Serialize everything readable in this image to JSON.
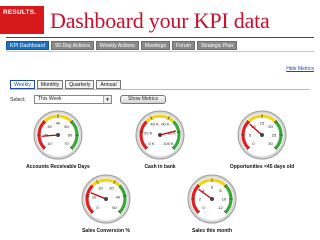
{
  "brand": {
    "line1": "RESULTS.",
    "line2": ""
  },
  "title": "Dashboard your KPI data",
  "main_tabs": [
    {
      "label": "KPI Dashboard",
      "active": true
    },
    {
      "label": "90 Day Actions",
      "active": false
    },
    {
      "label": "Weekly Actions",
      "active": false
    },
    {
      "label": "Meetings",
      "active": false
    },
    {
      "label": "Forum",
      "active": false
    },
    {
      "label": "Strategic Plan",
      "active": false
    }
  ],
  "hide_metrics_label": "Hide Metrics",
  "sub_tabs": [
    {
      "label": "Weekly",
      "active": true
    },
    {
      "label": "Monthly",
      "active": false
    },
    {
      "label": "Quarterly",
      "active": false
    },
    {
      "label": "Annual",
      "active": false
    }
  ],
  "select": {
    "label": "Select:",
    "value": "This Week",
    "arrow": "▼"
  },
  "show_metrics_label": "Show Metrics",
  "colors": {
    "brand_red": "#c8102e",
    "tab_blue": "#1e6fbd",
    "zone_red": "#e02020",
    "zone_yellow": "#f2d31b",
    "zone_green": "#35a83a"
  },
  "gauges": [
    {
      "label": "Accounts Receivable Days",
      "ticks": [
        "10",
        "20",
        "30",
        "40",
        "50",
        "60",
        "70"
      ],
      "zones": [
        "red",
        "yellow",
        "green"
      ],
      "value_fraction": 0.15
    },
    {
      "label": "Cash in bank",
      "ticks": [
        "0 K",
        "20 K",
        "40 K",
        "60 K",
        "80 K",
        "100 K"
      ],
      "zones": [
        "red",
        "yellow",
        "green"
      ],
      "value_fraction": 0.78
    },
    {
      "label": "Opportunities <45 days old",
      "ticks": [
        "0",
        "5",
        "10",
        "15",
        "20",
        "25",
        "30"
      ],
      "zones": [
        "red",
        "yellow",
        "green"
      ],
      "value_fraction": 0.32
    },
    {
      "label": "Sales Conversion %",
      "ticks": [
        "0",
        "10",
        "20",
        "30",
        "40",
        "50"
      ],
      "zones": [
        "red",
        "yellow",
        "green"
      ],
      "value_fraction": 0.25
    },
    {
      "label": "Sales this month",
      "ticks": [
        "0",
        "2",
        "4",
        "6",
        "8",
        "10",
        "12"
      ],
      "zones": [
        "red",
        "yellow",
        "green"
      ],
      "value_fraction": 0.3
    }
  ]
}
